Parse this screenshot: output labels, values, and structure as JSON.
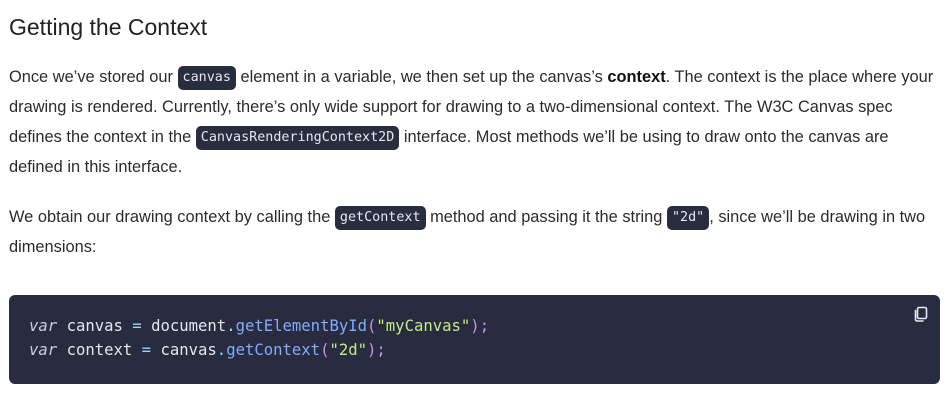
{
  "heading": "Getting the Context",
  "paragraph1": {
    "line1": {
      "t1": "Once we’ve stored our ",
      "code1": "canvas",
      "t2": " element in a variable, we then set up the canvas’s ",
      "bold": "context",
      "t3": ". The context is the place where your"
    },
    "line2": "drawing is rendered. Currently, there’s only wide support for drawing to a two-dimensional context. The W3C Canvas spec",
    "line3": {
      "t1": "defines the context in the ",
      "code1": "CanvasRenderingContext2D",
      "t2": " interface. Most methods we’ll be using to draw onto the canvas are"
    },
    "line4": "defined in this interface."
  },
  "paragraph2": {
    "line1": {
      "t1": "We obtain our drawing context by calling the ",
      "code1": "getContext",
      "t2": " method and passing it the string ",
      "code2": "\"2d\"",
      "t3": ", since we’ll be drawing in two"
    },
    "line2": "dimensions:"
  },
  "code_block": {
    "line1": {
      "kw": "var",
      "name": "canvas",
      "op": "=",
      "obj": "document",
      "dot": ".",
      "fn": "getElementById",
      "open": "(",
      "arg": "\"myCanvas\"",
      "close": ")",
      "semi": ";"
    },
    "line2": {
      "kw": "var",
      "name": "context",
      "op": "=",
      "obj": "canvas",
      "dot": ".",
      "fn": "getContext",
      "open": "(",
      "arg": "\"2d\"",
      "close": ")",
      "semi": ";"
    },
    "copy_icon": "copy-icon"
  },
  "colors": {
    "code_background": "#292c3e",
    "inline_code_background": "#2a2d3e",
    "string": "#c3e88d",
    "function": "#82aaff",
    "punctuation": "#c792ea"
  }
}
